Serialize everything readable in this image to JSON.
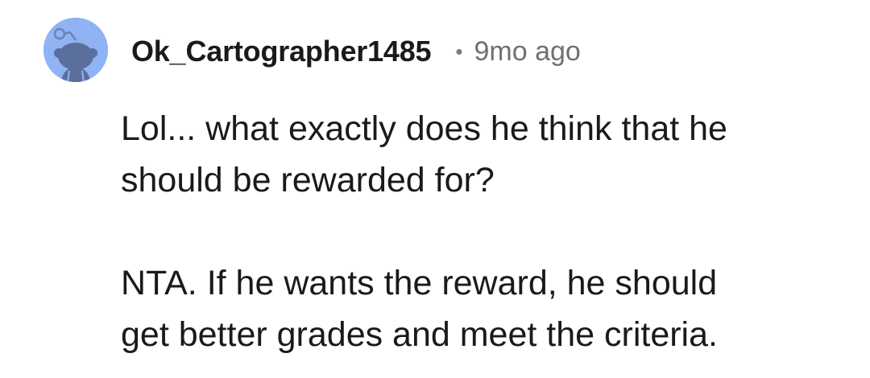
{
  "comment": {
    "author": {
      "username": "Ok_Cartographer1485",
      "avatar_icon": "snoo-avatar-icon",
      "avatar_color": "#8fb3f3"
    },
    "separator": "•",
    "timestamp": "9mo ago",
    "paragraphs": [
      "Lol... what exactly does he think that he\nshould be rewarded for?",
      "NTA. If he wants the reward, he should\nget better grades and meet the criteria."
    ]
  }
}
